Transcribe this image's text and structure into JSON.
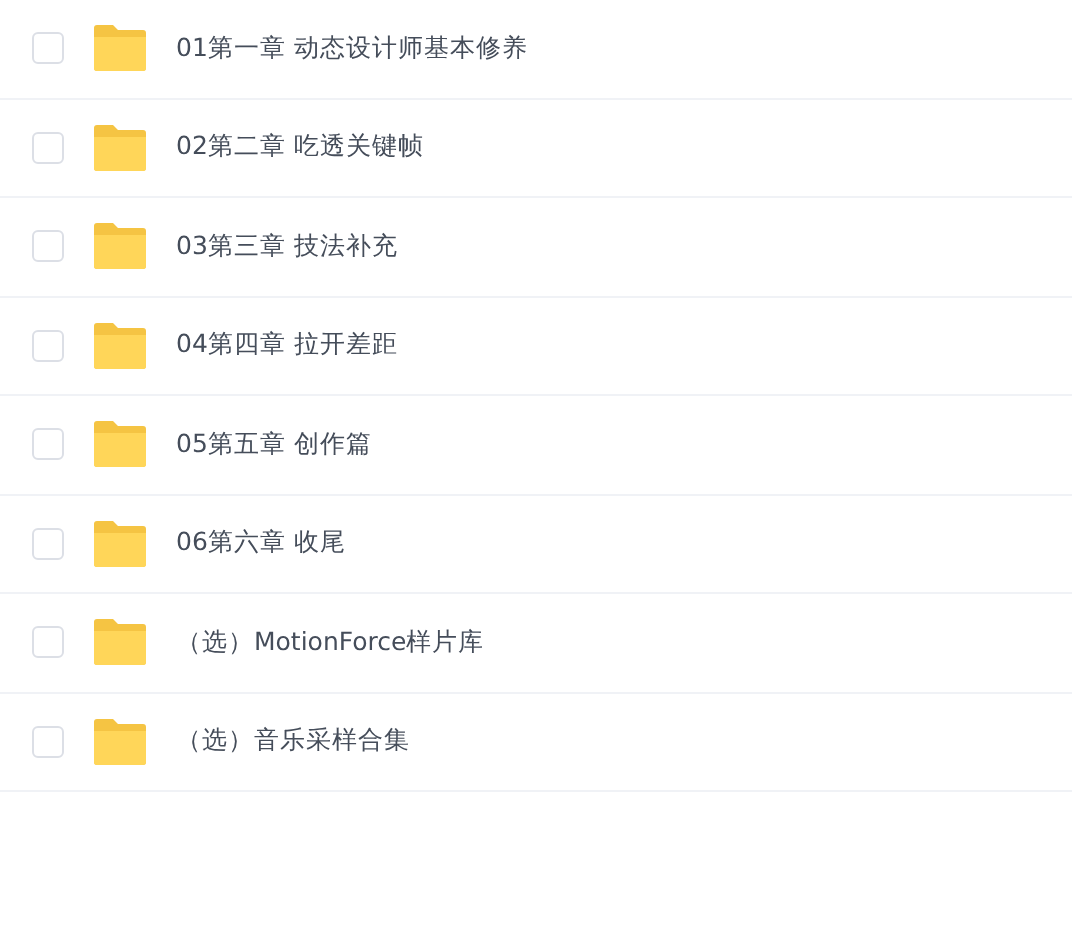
{
  "files": [
    {
      "name": "01第一章 动态设计师基本修养",
      "checked": false
    },
    {
      "name": "02第二章 吃透关键帧",
      "checked": false
    },
    {
      "name": "03第三章 技法补充",
      "checked": false
    },
    {
      "name": "04第四章 拉开差距",
      "checked": false
    },
    {
      "name": "05第五章 创作篇",
      "checked": false
    },
    {
      "name": "06第六章 收尾",
      "checked": false
    },
    {
      "name": "（选）MotionForce样片库",
      "checked": false
    },
    {
      "name": "（选）音乐采样合集",
      "checked": false
    }
  ]
}
